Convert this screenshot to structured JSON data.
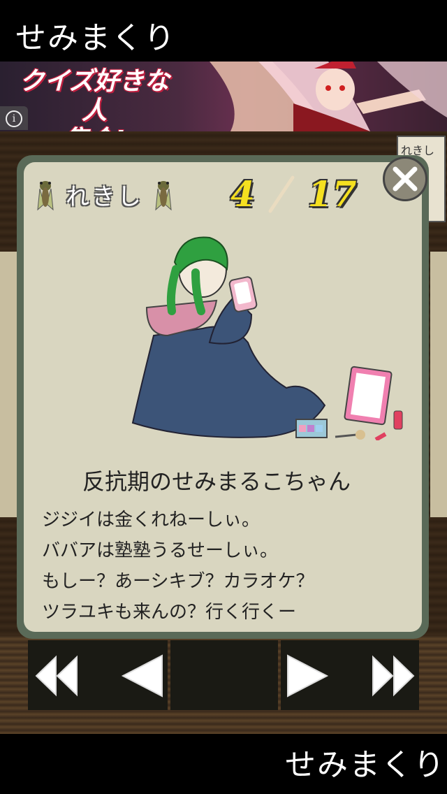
{
  "app": {
    "title": "せみまくり",
    "footer_title": "せみまくり"
  },
  "ad": {
    "line1": "クイズ好きな人",
    "line2": "集合!",
    "info_label": "i"
  },
  "background": {
    "panel_label": "れきし"
  },
  "card": {
    "category": "れきし",
    "current_page": "4",
    "total_pages": "17",
    "entry_title": "反抗期のせみまるこちゃん",
    "entry_lines": [
      "ジジイは金くれねーしぃ。",
      "ババアは塾塾うるせーしぃ。",
      "もしー？あーシキブ？カラオケ？",
      "ツラユキも来んの？行く行くー"
    ]
  },
  "nav": {
    "buttons": [
      "first",
      "previous",
      "next",
      "last"
    ]
  },
  "colors": {
    "card_border": "#5a6a58",
    "card_bg": "#d9d6c0",
    "counter": "#f5e020"
  }
}
